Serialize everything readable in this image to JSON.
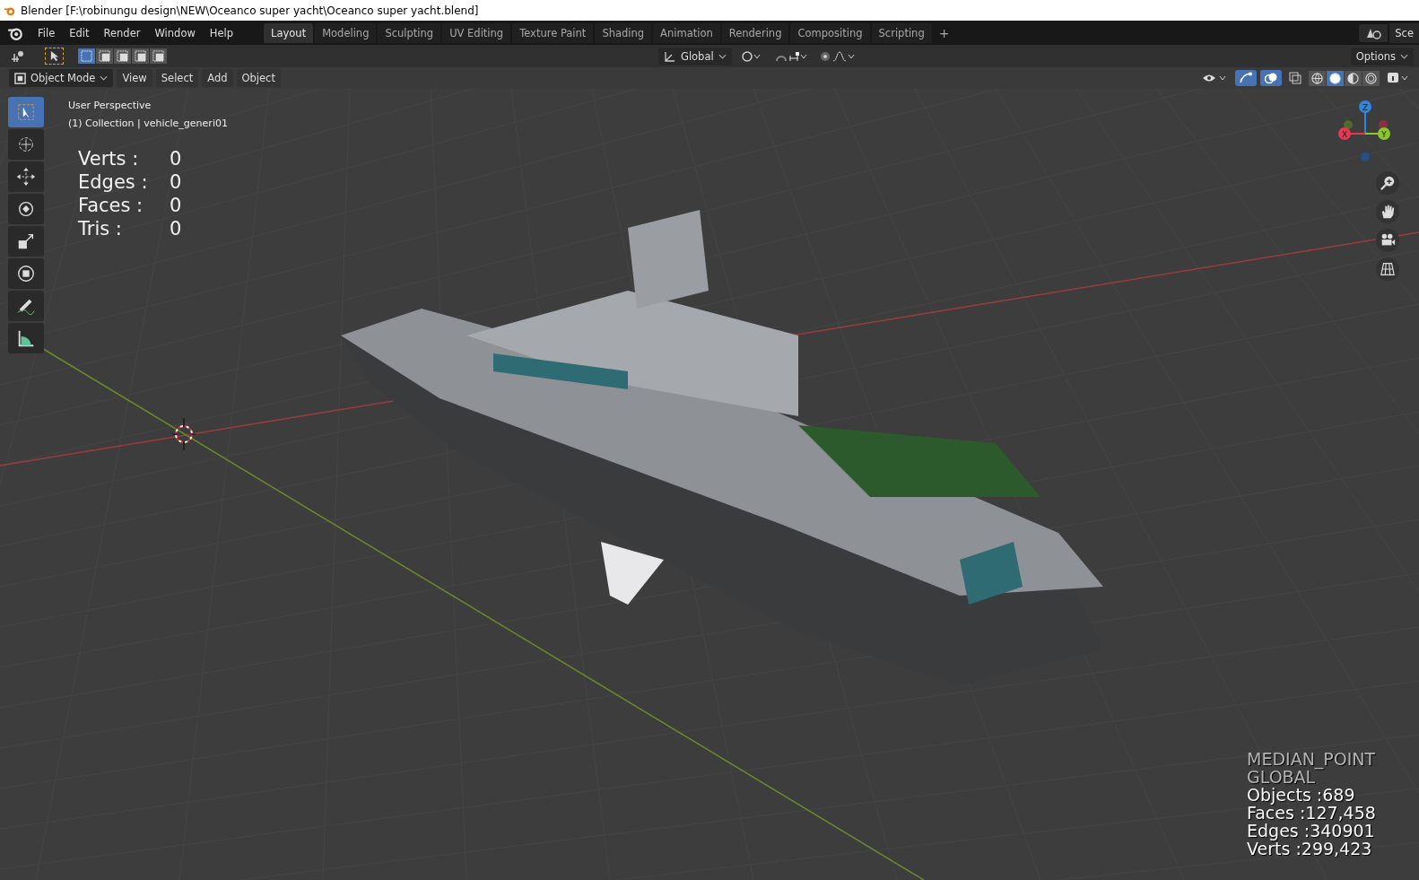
{
  "window": {
    "title": "Blender [F:\\robinungu design\\NEW\\Oceanco super yacht\\Oceanco super yacht.blend]"
  },
  "menu": [
    "File",
    "Edit",
    "Render",
    "Window",
    "Help"
  ],
  "workspaces": [
    {
      "label": "Layout",
      "selected": true
    },
    {
      "label": "Modeling",
      "selected": false
    },
    {
      "label": "Sculpting",
      "selected": false
    },
    {
      "label": "UV Editing",
      "selected": false
    },
    {
      "label": "Texture Paint",
      "selected": false
    },
    {
      "label": "Shading",
      "selected": false
    },
    {
      "label": "Animation",
      "selected": false
    },
    {
      "label": "Rendering",
      "selected": false
    },
    {
      "label": "Compositing",
      "selected": false
    },
    {
      "label": "Scripting",
      "selected": false
    }
  ],
  "add_workspace": "+",
  "scene": {
    "label": "Sce"
  },
  "tool_header": {
    "select_modes": [
      {
        "selected": true
      },
      {
        "selected": false
      },
      {
        "selected": false
      },
      {
        "selected": false
      },
      {
        "selected": false
      }
    ],
    "orientation": "Global",
    "options": "Options"
  },
  "viewport_header": {
    "mode": "Object Mode",
    "menus": [
      "View",
      "Select",
      "Add",
      "Object"
    ],
    "shading_modes": [
      {
        "selected": false
      },
      {
        "selected": true
      },
      {
        "selected": false
      },
      {
        "selected": false
      }
    ]
  },
  "tools": [
    {
      "selected": true
    },
    {
      "selected": false
    },
    {
      "selected": false
    },
    {
      "selected": false
    },
    {
      "selected": false
    },
    {
      "selected": false
    },
    {
      "selected": false
    },
    {
      "selected": false
    }
  ],
  "overlay": {
    "view": "User Perspective",
    "object": "(1) Collection | vehicle_generi01",
    "stats": [
      {
        "label": "Verts :",
        "value": "0"
      },
      {
        "label": "Edges :",
        "value": "0"
      },
      {
        "label": "Faces :",
        "value": "0"
      },
      {
        "label": "Tris :",
        "value": "0"
      }
    ]
  },
  "gizmo": {
    "axes": [
      "X",
      "Y",
      "Z"
    ]
  },
  "scene_stats": [
    {
      "kind": "mode",
      "text": "MEDIAN_POINT"
    },
    {
      "kind": "mode",
      "text": "GLOBAL"
    },
    {
      "kind": "count",
      "text": "Objects :689"
    },
    {
      "kind": "count",
      "text": "Faces :127,458"
    },
    {
      "kind": "count",
      "text": "Edges :340901"
    },
    {
      "kind": "count",
      "text": "Verts :299,423"
    }
  ]
}
